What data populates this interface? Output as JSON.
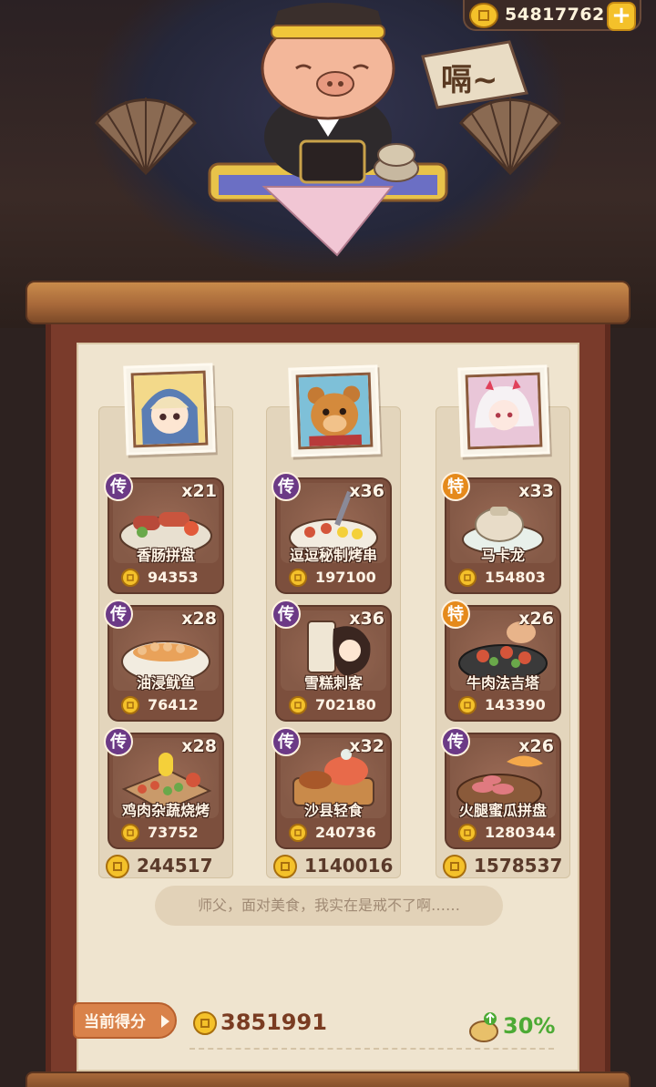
{
  "header": {
    "coins": "54817762",
    "plus_label": "+",
    "speech_tag": "嗝~"
  },
  "columns": [
    {
      "customer": "blonde-hooded-girl",
      "total": "244517",
      "dishes": [
        {
          "tier": "传",
          "tier_type": "legend",
          "qty": "x21",
          "name": "香肠拼盘",
          "price": "94353"
        },
        {
          "tier": "传",
          "tier_type": "legend",
          "qty": "x28",
          "name": "油浸鱿鱼",
          "price": "76412"
        },
        {
          "tier": "传",
          "tier_type": "legend",
          "qty": "x28",
          "name": "鸡肉杂蔬烧烤",
          "price": "73752"
        }
      ]
    },
    {
      "customer": "bear-warrior",
      "total": "1140016",
      "dishes": [
        {
          "tier": "传",
          "tier_type": "legend",
          "qty": "x36",
          "name": "逗逗秘制烤串",
          "price": "197100"
        },
        {
          "tier": "传",
          "tier_type": "legend",
          "qty": "x36",
          "name": "雪糕刺客",
          "price": "702180"
        },
        {
          "tier": "传",
          "tier_type": "legend",
          "qty": "x32",
          "name": "沙县轻食",
          "price": "240736"
        }
      ]
    },
    {
      "customer": "white-haired-demon",
      "total": "1578537",
      "dishes": [
        {
          "tier": "特",
          "tier_type": "special",
          "qty": "x33",
          "name": "马卡龙",
          "price": "154803"
        },
        {
          "tier": "特",
          "tier_type": "special",
          "qty": "x26",
          "name": "牛肉法吉塔",
          "price": "143390"
        },
        {
          "tier": "传",
          "tier_type": "legend",
          "qty": "x26",
          "name": "火腿蜜瓜拼盘",
          "price": "1280344"
        }
      ]
    }
  ],
  "quote": "师父，面对美食，我实在是戒不了啊……",
  "score": {
    "label": "当前得分",
    "value": "3851991",
    "bonus": "30%"
  },
  "colors": {
    "legend_tier": "#6c3a86",
    "special_tier": "#e58a1c",
    "bonus_green": "#4caa34",
    "coin_gold": "#f4c12a"
  }
}
